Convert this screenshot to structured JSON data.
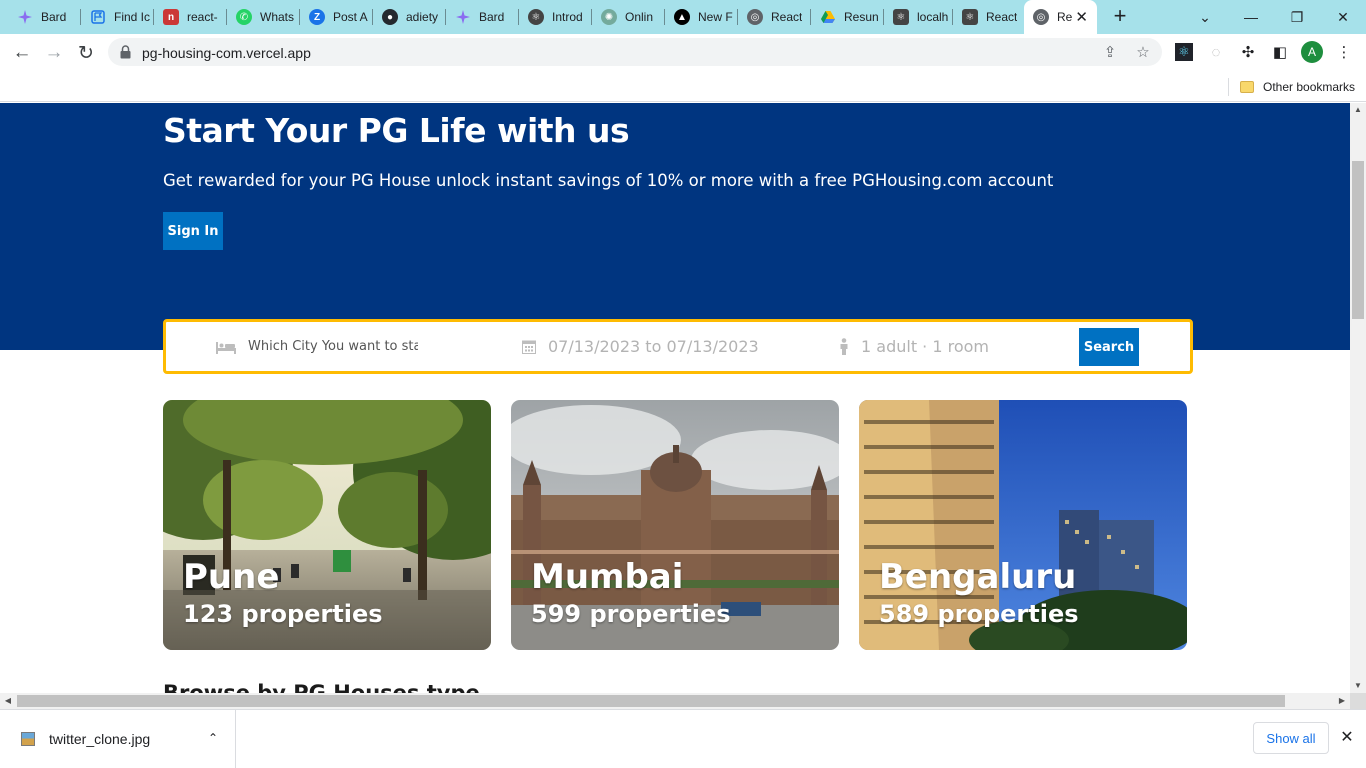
{
  "browser": {
    "tabs": [
      {
        "title": "Bard",
        "icon": "bard-icon",
        "color": "#4285f4"
      },
      {
        "title": "Find Ic",
        "icon": "flag-icon",
        "color": "#1a73e8"
      },
      {
        "title": "react-",
        "icon": "npm-icon",
        "color": "#cb3837"
      },
      {
        "title": "Whats",
        "icon": "whatsapp-icon",
        "color": "#25d366"
      },
      {
        "title": "Post A",
        "icon": "z-icon",
        "color": "#1a73e8"
      },
      {
        "title": "adiety",
        "icon": "github-icon",
        "color": "#24292f"
      },
      {
        "title": "Bard",
        "icon": "bard-icon",
        "color": "#4285f4"
      },
      {
        "title": "Introd",
        "icon": "react-icon",
        "color": "#444"
      },
      {
        "title": "Onlin",
        "icon": "openai-icon",
        "color": "#74aa9c"
      },
      {
        "title": "New F",
        "icon": "vercel-icon",
        "color": "#000"
      },
      {
        "title": "React",
        "icon": "globe-icon",
        "color": "#5f6368"
      },
      {
        "title": "Resun",
        "icon": "drive-icon",
        "color": "#fbbc04"
      },
      {
        "title": "localh",
        "icon": "react-icon",
        "color": "#444"
      },
      {
        "title": "React",
        "icon": "react-icon",
        "color": "#444"
      },
      {
        "title": "Re",
        "icon": "globe-icon",
        "color": "#5f6368",
        "active": true
      }
    ],
    "url": "pg-housing-com.vercel.app",
    "bookmarks": {
      "other": "Other bookmarks"
    },
    "profile_initial": "A"
  },
  "hero": {
    "title": "Start Your PG Life with us",
    "subtitle": "Get rewarded for your PG House unlock instant savings of 10% or more with a free PGHousing.com account",
    "signin_label": "Sign In"
  },
  "search": {
    "city_placeholder": "Which City You want to stay ?",
    "dates": "07/13/2023 to 07/13/2023",
    "guests": "1 adult · 1 room",
    "button_label": "Search"
  },
  "cities": [
    {
      "name": "Pune",
      "properties": "123 properties"
    },
    {
      "name": "Mumbai",
      "properties": "599 properties"
    },
    {
      "name": "Bengaluru",
      "properties": "589 properties"
    }
  ],
  "section_heading": "Browse by PG Houses type",
  "downloads": {
    "file": "twitter_clone.jpg",
    "show_all": "Show all"
  },
  "colors": {
    "hero_bg": "#003580",
    "button": "#0071c2",
    "search_border": "#febb02",
    "tab_strip": "#a6e1ea"
  }
}
